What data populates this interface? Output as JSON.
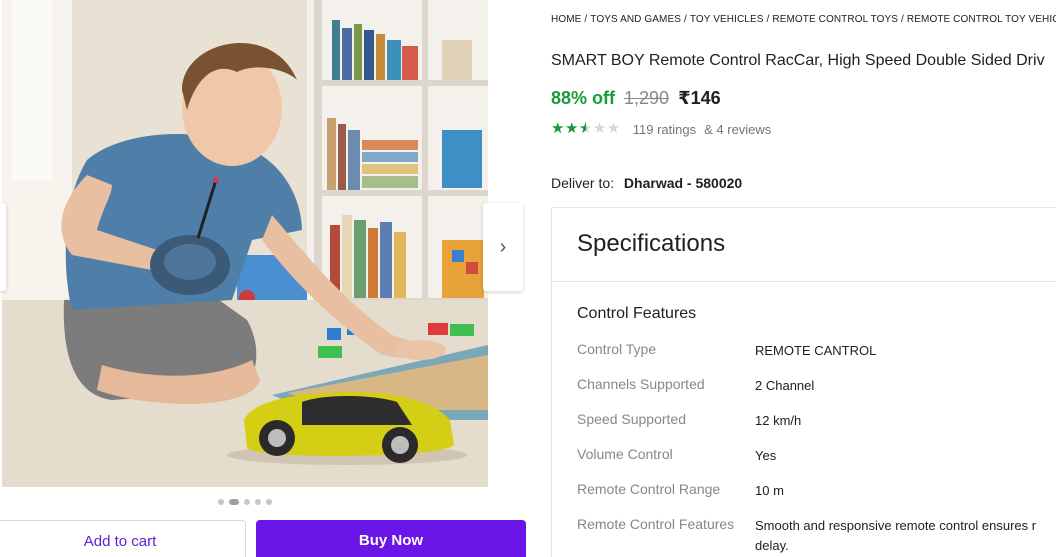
{
  "gallery": {
    "image_alt": "Boy playing with a yellow remote control car",
    "nav_next_glyph": "›",
    "nav_prev_glyph": "‹",
    "dot_count": 5,
    "active_dot": 1
  },
  "actions": {
    "add_to_cart": "Add to cart",
    "buy_now": "Buy Now"
  },
  "breadcrumb": [
    "HOME",
    "TOYS AND GAMES",
    "TOY VEHICLES",
    "REMOTE CONTROL TOYS",
    "REMOTE CONTROL TOY VEHICL"
  ],
  "product": {
    "title": "SMART BOY Remote Control RacCar, High Speed Double Sided Driv",
    "discount": "88% off",
    "mrp": "1,290",
    "price": "₹146",
    "rating_fraction": 0.5,
    "ratings_text": "119 ratings",
    "reviews_text": "& 4 reviews"
  },
  "delivery": {
    "label": "Deliver to:",
    "location": "Dharwad - 580020"
  },
  "specifications": {
    "title": "Specifications",
    "group": "Control Features",
    "rows": [
      {
        "key": "Control Type",
        "value": "REMOTE CANTROL"
      },
      {
        "key": "Channels Supported",
        "value": "2 Channel"
      },
      {
        "key": "Speed Supported",
        "value": "12 km/h"
      },
      {
        "key": "Volume Control",
        "value": "Yes"
      },
      {
        "key": "Remote Control Range",
        "value": "10 m"
      },
      {
        "key": "Remote Control Features",
        "value": "Smooth and responsive remote control ensures r delay."
      }
    ]
  },
  "colors": {
    "discount_green": "#1a9b3a",
    "star_green": "#159a3c",
    "buy_purple": "#6a14e8",
    "cart_text_purple": "#5b21d6"
  }
}
